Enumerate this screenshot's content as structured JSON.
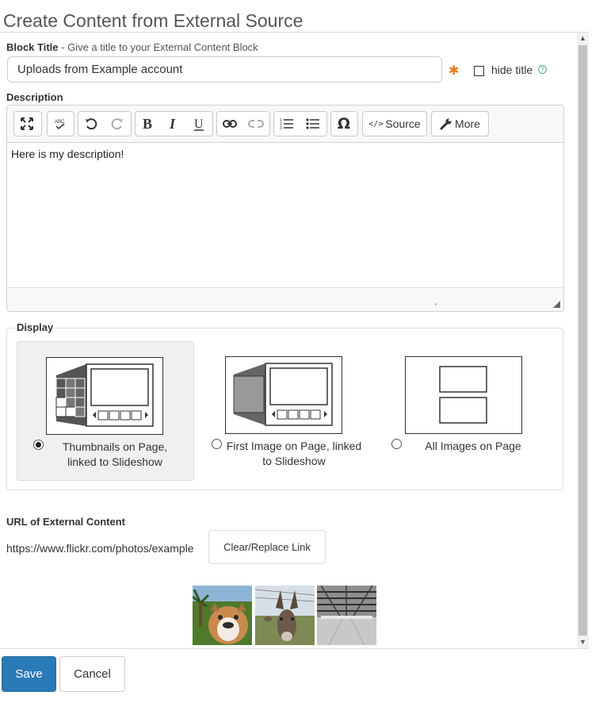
{
  "page": {
    "title": "Create Content from External Source"
  },
  "block_title": {
    "label": "Block Title",
    "hint": " - Give a title to your External Content Block",
    "value": "Uploads from Example account",
    "required_mark": "✱",
    "hide_title_label": "hide title",
    "help_mark": "?"
  },
  "description": {
    "label": "Description",
    "toolbar": {
      "source_label": "Source",
      "more_label": "More"
    },
    "content": "Here is my description!"
  },
  "display": {
    "legend": "Display",
    "options": [
      {
        "label": "Thumbnails on Page, linked to Slideshow",
        "selected": true
      },
      {
        "label": "First Image on Page, linked to Slideshow",
        "selected": false
      },
      {
        "label": "All Images on Page",
        "selected": false
      }
    ]
  },
  "external": {
    "label": "URL of External Content",
    "url": "https://www.flickr.com/photos/example",
    "clear_label": "Clear/Replace Link",
    "thumbnails": [
      {
        "name": "bulldog-photo",
        "accent": "#c98a4e"
      },
      {
        "name": "donkey-photo",
        "accent": "#6b5a49"
      },
      {
        "name": "warehouse-photo",
        "accent": "#8e8e8e"
      }
    ]
  },
  "footer": {
    "save_label": "Save",
    "cancel_label": "Cancel"
  },
  "colors": {
    "primary": "#2a7ab8",
    "required": "#e67e22",
    "help": "#44aa99"
  }
}
